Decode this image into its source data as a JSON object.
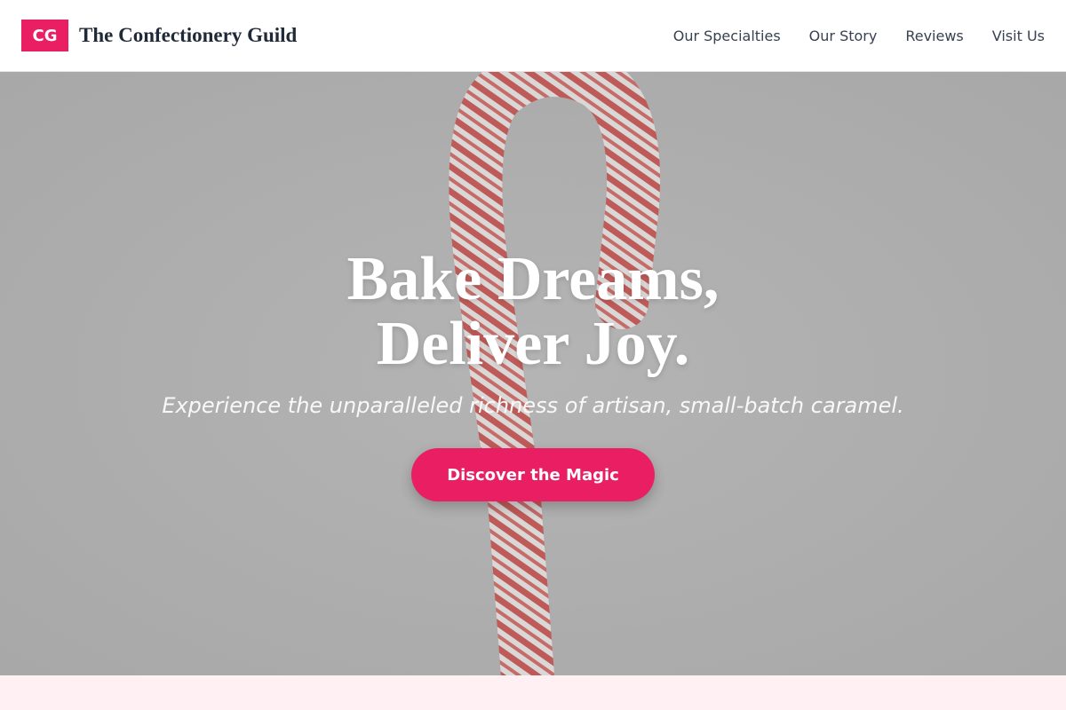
{
  "header": {
    "logo_text": "CG",
    "brand_name": "The Confectionery Guild",
    "nav": [
      {
        "label": "Our Specialties"
      },
      {
        "label": "Our Story"
      },
      {
        "label": "Reviews"
      },
      {
        "label": "Visit Us"
      }
    ]
  },
  "hero": {
    "title_line1": "Bake Dreams,",
    "title_line2": "Deliver Joy.",
    "subtitle": "Experience the unparalleled richness of artisan, small-batch caramel.",
    "cta_label": "Discover the Magic",
    "background_image": "candy-cane"
  },
  "colors": {
    "accent": "#e91e63",
    "hero_overlay": "#acacac",
    "next_section_bg": "#fff0f4"
  }
}
